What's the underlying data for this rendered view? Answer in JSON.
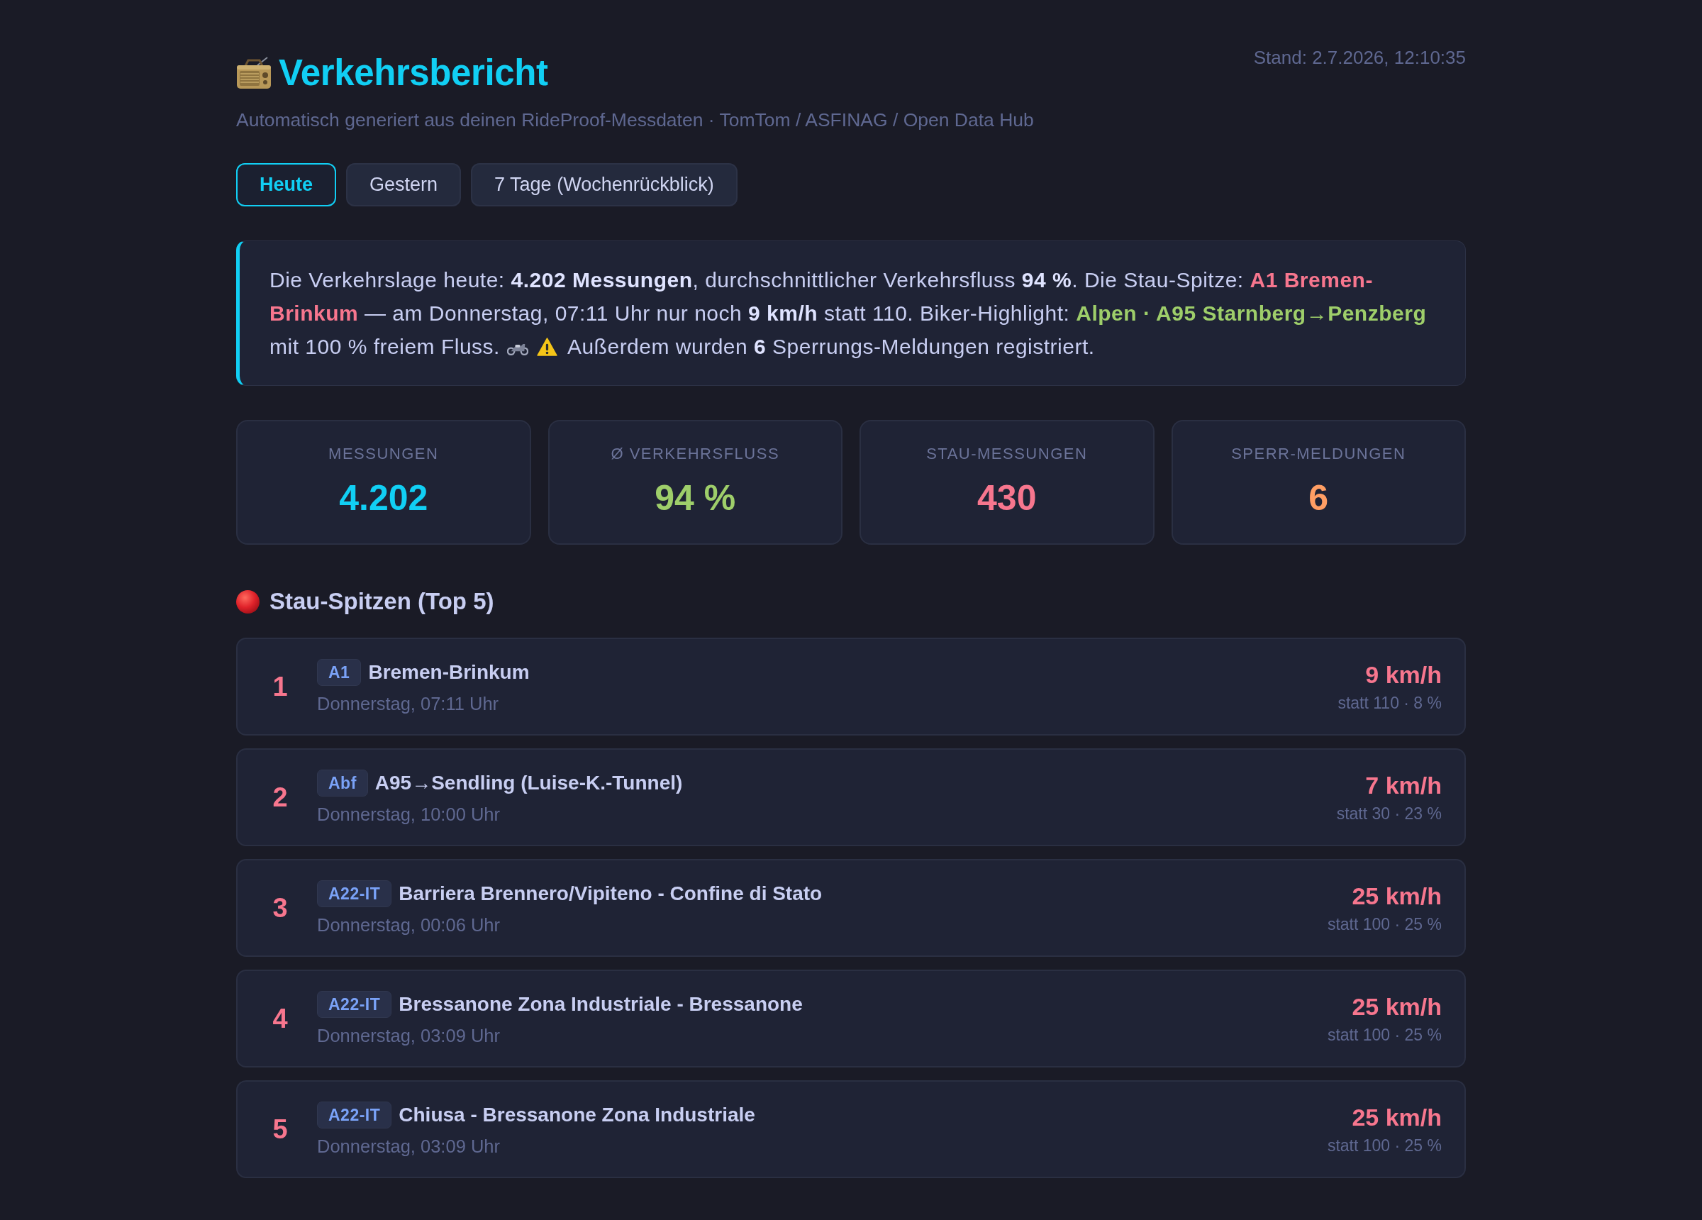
{
  "header": {
    "title": "Verkehrsbericht",
    "timestamp": "Stand: 2.7.2026, 12:10:35",
    "subtitle": "Automatisch generiert aus deinen RideProof-Messdaten · TomTom / ASFINAG / Open Data Hub"
  },
  "tabs": [
    {
      "label": "Heute",
      "selected": true
    },
    {
      "label": "Gestern",
      "selected": false
    },
    {
      "label": "7 Tage (Wochenrückblick)",
      "selected": false
    }
  ],
  "summary": {
    "text": [
      {
        "kind": "plain",
        "text": "Die Verkehrslage heute: "
      },
      {
        "kind": "bold",
        "text": "4.202 Messungen"
      },
      {
        "kind": "plain",
        "text": ", durchschnittlicher Verkehrsfluss "
      },
      {
        "kind": "bold",
        "text": "94 %"
      },
      {
        "kind": "plain",
        "text": ". Die Stau-Spitze: "
      },
      {
        "kind": "jam",
        "text": "A1 Bremen-Brinkum"
      },
      {
        "kind": "plain",
        "text": " — am Donnerstag, 07:11 Uhr nur noch "
      },
      {
        "kind": "bold",
        "text": "9 km/h"
      },
      {
        "kind": "plain",
        "text": " statt 110. Biker-Highlight: "
      },
      {
        "kind": "good",
        "text": "Alpen · A95 Starnberg→Penzberg"
      },
      {
        "kind": "plain",
        "text": " mit 100 % freiem Fluss."
      }
    ],
    "note": [
      {
        "kind": "plain",
        "text": "Außerdem wurden "
      },
      {
        "kind": "bold",
        "text": "6"
      },
      {
        "kind": "plain",
        "text": " Sperrungs-Meldungen registriert."
      }
    ]
  },
  "stats": [
    {
      "label": "MESSUNGEN",
      "value": "4.202",
      "color": "#11cff4"
    },
    {
      "label": "Ø VERKEHRSFLUSS",
      "value": "94 %",
      "color": "#9ece6a"
    },
    {
      "label": "STAU-MESSUNGEN",
      "value": "430",
      "color": "#f7768e"
    },
    {
      "label": "SPERR-MELDUNGEN",
      "value": "6",
      "color": "#ff9e64"
    }
  ],
  "jam_section": {
    "title": "Stau-Spitzen (Top 5)",
    "items": [
      {
        "rank": "1",
        "road": "A1",
        "name": "Bremen-Brinkum",
        "time": "Donnerstag, 07:11 Uhr",
        "speed": "9 km/h",
        "detail": "statt 110 · 8 %"
      },
      {
        "rank": "2",
        "road": "Abf",
        "name": "A95→Sendling (Luise-K.-Tunnel)",
        "time": "Donnerstag, 10:00 Uhr",
        "speed": "7 km/h",
        "detail": "statt 30 · 23 %"
      },
      {
        "rank": "3",
        "road": "A22-IT",
        "name": "Barriera Brennero/Vipiteno - Confine di Stato",
        "time": "Donnerstag, 00:06 Uhr",
        "speed": "25 km/h",
        "detail": "statt 100 · 25 %"
      },
      {
        "rank": "4",
        "road": "A22-IT",
        "name": "Bressanone Zona Industriale - Bressanone",
        "time": "Donnerstag, 03:09 Uhr",
        "speed": "25 km/h",
        "detail": "statt 100 · 25 %"
      },
      {
        "rank": "5",
        "road": "A22-IT",
        "name": "Chiusa - Bressanone Zona Industriale",
        "time": "Donnerstag, 03:09 Uhr",
        "speed": "25 km/h",
        "detail": "statt 100 · 25 %"
      }
    ]
  }
}
